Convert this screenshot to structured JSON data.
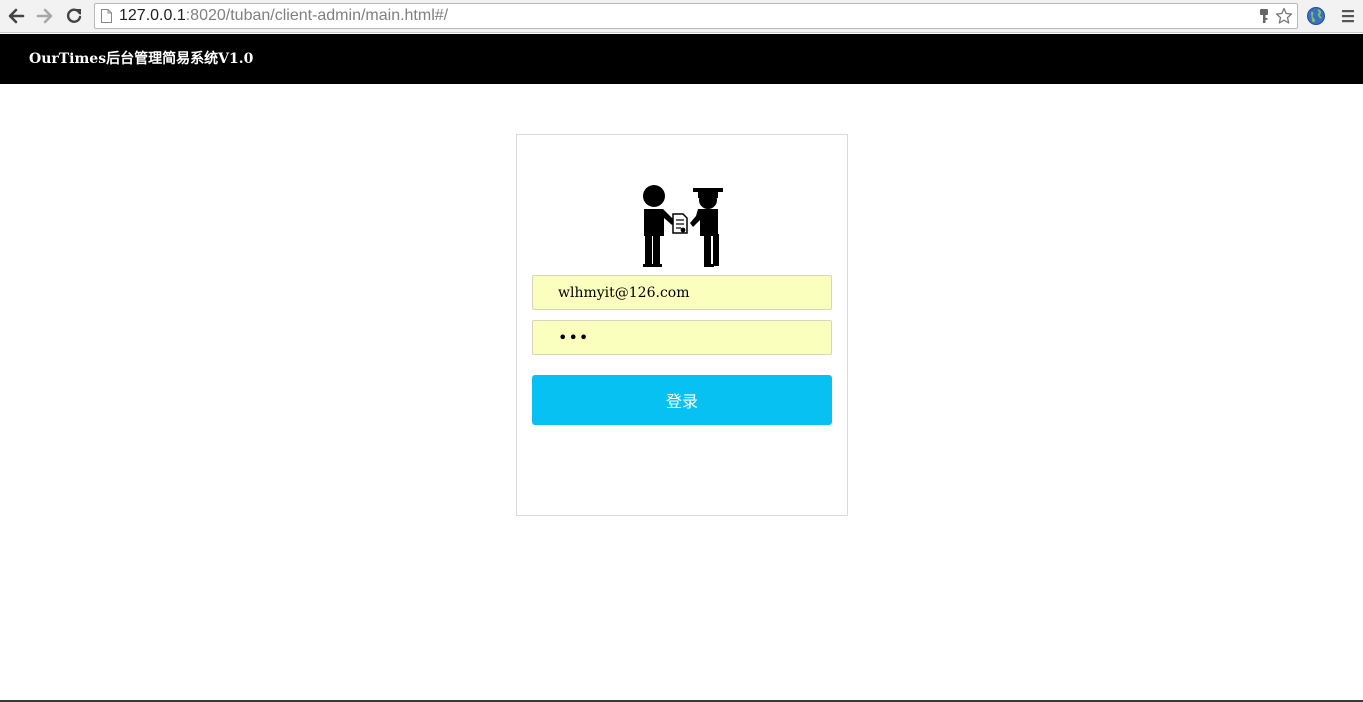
{
  "browser": {
    "url_host": "127.0.0.1",
    "url_rest": ":8020/tuban/client-admin/main.html#/",
    "icons": {
      "back": "back-arrow-icon",
      "forward": "forward-arrow-icon",
      "reload": "reload-icon",
      "page": "page-icon",
      "key": "key-icon",
      "bookmark": "star-icon",
      "extension": "globe-icon",
      "menu": "hamburger-menu-icon"
    }
  },
  "header": {
    "title": "OurTimes后台管理简易系统V1.0",
    "background": "#000000"
  },
  "login": {
    "logo": "graduation-handshake-logo",
    "email_value": "wlhmyit@126.com",
    "password_value": "•••",
    "autofill_color": "#faffbd",
    "button_label": "登录",
    "button_color": "#06c1f1"
  }
}
